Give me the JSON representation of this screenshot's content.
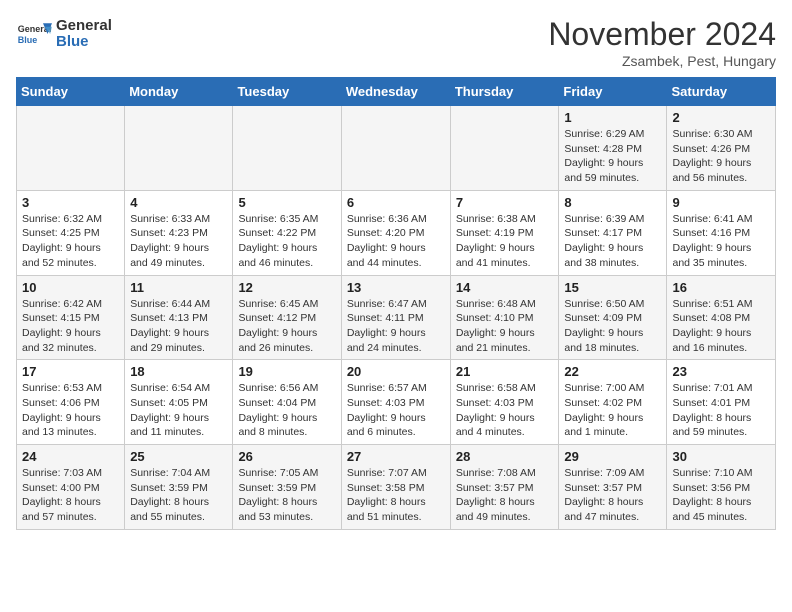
{
  "header": {
    "logo": {
      "general": "General",
      "blue": "Blue"
    },
    "month": "November 2024",
    "location": "Zsambek, Pest, Hungary"
  },
  "weekdays": [
    "Sunday",
    "Monday",
    "Tuesday",
    "Wednesday",
    "Thursday",
    "Friday",
    "Saturday"
  ],
  "weeks": [
    [
      {
        "day": "",
        "info": ""
      },
      {
        "day": "",
        "info": ""
      },
      {
        "day": "",
        "info": ""
      },
      {
        "day": "",
        "info": ""
      },
      {
        "day": "",
        "info": ""
      },
      {
        "day": "1",
        "info": "Sunrise: 6:29 AM\nSunset: 4:28 PM\nDaylight: 9 hours and 59 minutes."
      },
      {
        "day": "2",
        "info": "Sunrise: 6:30 AM\nSunset: 4:26 PM\nDaylight: 9 hours and 56 minutes."
      }
    ],
    [
      {
        "day": "3",
        "info": "Sunrise: 6:32 AM\nSunset: 4:25 PM\nDaylight: 9 hours and 52 minutes."
      },
      {
        "day": "4",
        "info": "Sunrise: 6:33 AM\nSunset: 4:23 PM\nDaylight: 9 hours and 49 minutes."
      },
      {
        "day": "5",
        "info": "Sunrise: 6:35 AM\nSunset: 4:22 PM\nDaylight: 9 hours and 46 minutes."
      },
      {
        "day": "6",
        "info": "Sunrise: 6:36 AM\nSunset: 4:20 PM\nDaylight: 9 hours and 44 minutes."
      },
      {
        "day": "7",
        "info": "Sunrise: 6:38 AM\nSunset: 4:19 PM\nDaylight: 9 hours and 41 minutes."
      },
      {
        "day": "8",
        "info": "Sunrise: 6:39 AM\nSunset: 4:17 PM\nDaylight: 9 hours and 38 minutes."
      },
      {
        "day": "9",
        "info": "Sunrise: 6:41 AM\nSunset: 4:16 PM\nDaylight: 9 hours and 35 minutes."
      }
    ],
    [
      {
        "day": "10",
        "info": "Sunrise: 6:42 AM\nSunset: 4:15 PM\nDaylight: 9 hours and 32 minutes."
      },
      {
        "day": "11",
        "info": "Sunrise: 6:44 AM\nSunset: 4:13 PM\nDaylight: 9 hours and 29 minutes."
      },
      {
        "day": "12",
        "info": "Sunrise: 6:45 AM\nSunset: 4:12 PM\nDaylight: 9 hours and 26 minutes."
      },
      {
        "day": "13",
        "info": "Sunrise: 6:47 AM\nSunset: 4:11 PM\nDaylight: 9 hours and 24 minutes."
      },
      {
        "day": "14",
        "info": "Sunrise: 6:48 AM\nSunset: 4:10 PM\nDaylight: 9 hours and 21 minutes."
      },
      {
        "day": "15",
        "info": "Sunrise: 6:50 AM\nSunset: 4:09 PM\nDaylight: 9 hours and 18 minutes."
      },
      {
        "day": "16",
        "info": "Sunrise: 6:51 AM\nSunset: 4:08 PM\nDaylight: 9 hours and 16 minutes."
      }
    ],
    [
      {
        "day": "17",
        "info": "Sunrise: 6:53 AM\nSunset: 4:06 PM\nDaylight: 9 hours and 13 minutes."
      },
      {
        "day": "18",
        "info": "Sunrise: 6:54 AM\nSunset: 4:05 PM\nDaylight: 9 hours and 11 minutes."
      },
      {
        "day": "19",
        "info": "Sunrise: 6:56 AM\nSunset: 4:04 PM\nDaylight: 9 hours and 8 minutes."
      },
      {
        "day": "20",
        "info": "Sunrise: 6:57 AM\nSunset: 4:03 PM\nDaylight: 9 hours and 6 minutes."
      },
      {
        "day": "21",
        "info": "Sunrise: 6:58 AM\nSunset: 4:03 PM\nDaylight: 9 hours and 4 minutes."
      },
      {
        "day": "22",
        "info": "Sunrise: 7:00 AM\nSunset: 4:02 PM\nDaylight: 9 hours and 1 minute."
      },
      {
        "day": "23",
        "info": "Sunrise: 7:01 AM\nSunset: 4:01 PM\nDaylight: 8 hours and 59 minutes."
      }
    ],
    [
      {
        "day": "24",
        "info": "Sunrise: 7:03 AM\nSunset: 4:00 PM\nDaylight: 8 hours and 57 minutes."
      },
      {
        "day": "25",
        "info": "Sunrise: 7:04 AM\nSunset: 3:59 PM\nDaylight: 8 hours and 55 minutes."
      },
      {
        "day": "26",
        "info": "Sunrise: 7:05 AM\nSunset: 3:59 PM\nDaylight: 8 hours and 53 minutes."
      },
      {
        "day": "27",
        "info": "Sunrise: 7:07 AM\nSunset: 3:58 PM\nDaylight: 8 hours and 51 minutes."
      },
      {
        "day": "28",
        "info": "Sunrise: 7:08 AM\nSunset: 3:57 PM\nDaylight: 8 hours and 49 minutes."
      },
      {
        "day": "29",
        "info": "Sunrise: 7:09 AM\nSunset: 3:57 PM\nDaylight: 8 hours and 47 minutes."
      },
      {
        "day": "30",
        "info": "Sunrise: 7:10 AM\nSunset: 3:56 PM\nDaylight: 8 hours and 45 minutes."
      }
    ]
  ]
}
